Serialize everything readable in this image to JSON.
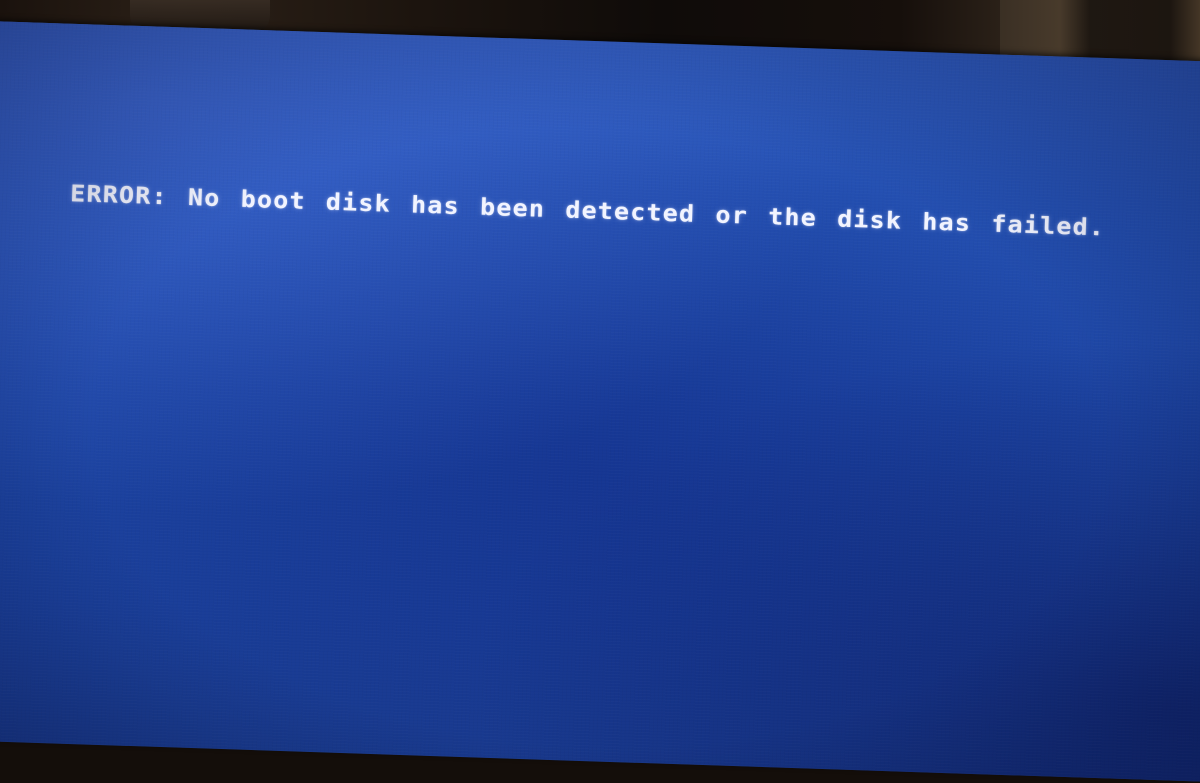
{
  "screen": {
    "background_color": "#1f47a8",
    "text_color": "#f2f4ff",
    "error_message": "ERROR: No boot disk has been detected or the disk has failed."
  }
}
